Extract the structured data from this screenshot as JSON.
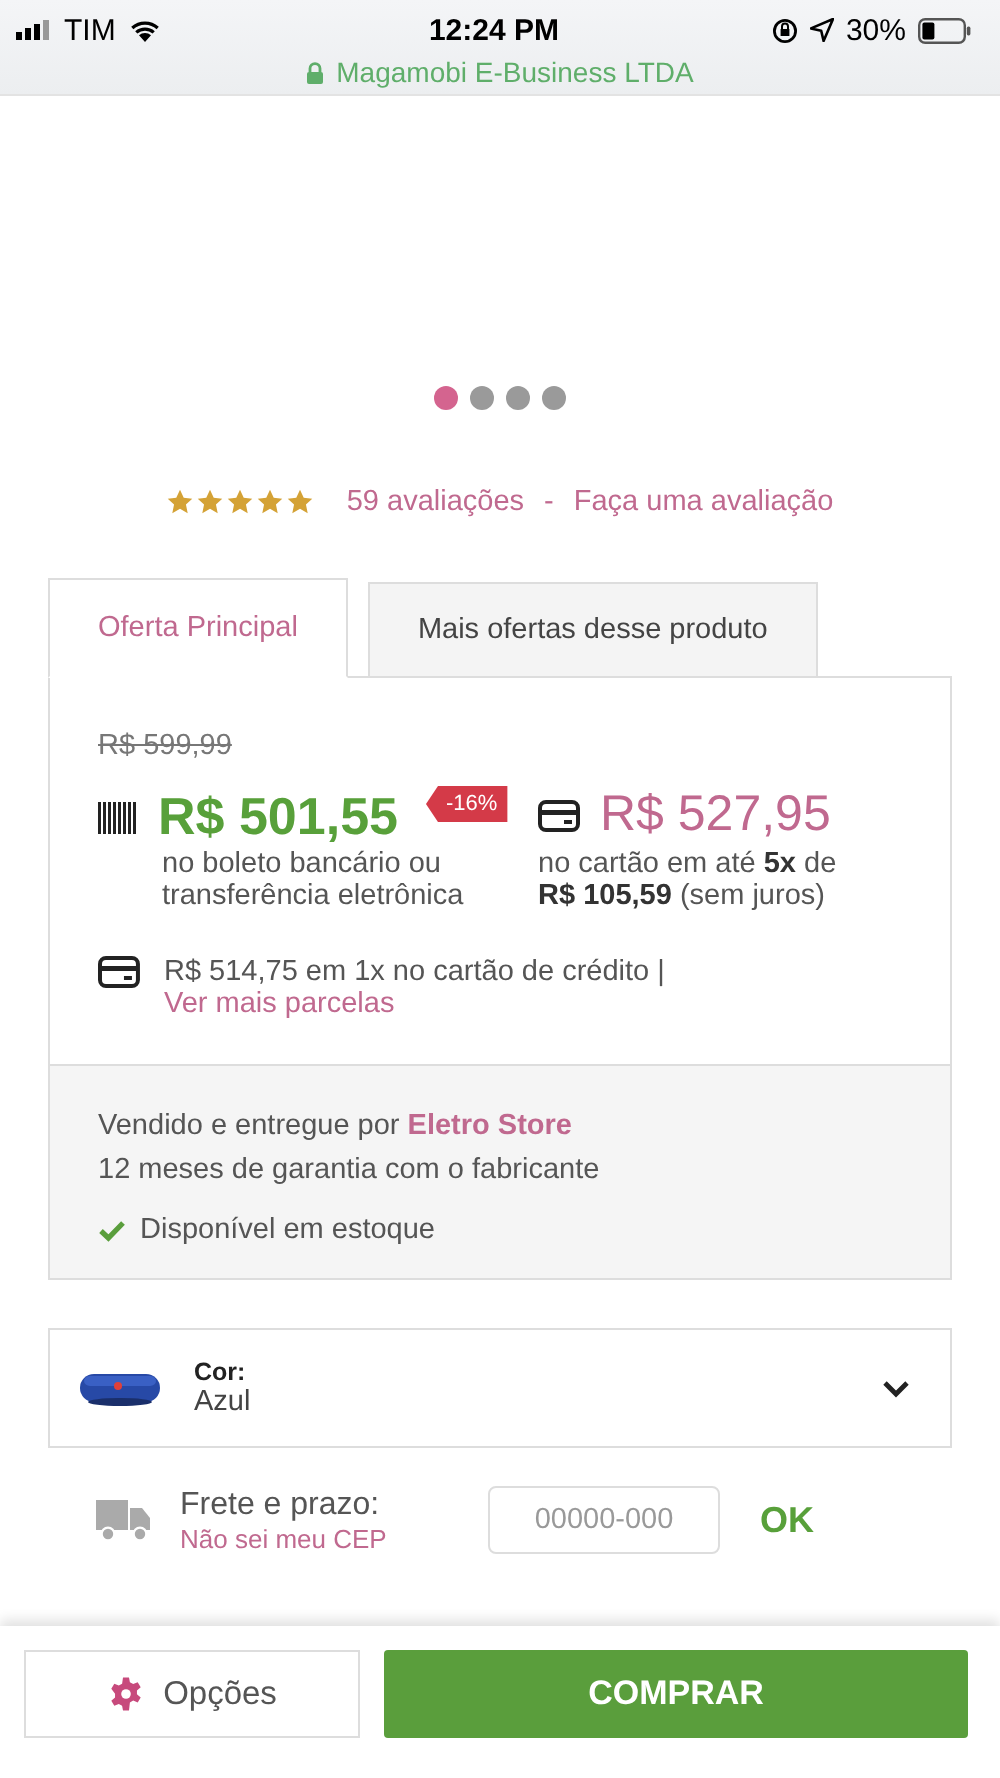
{
  "status_bar": {
    "carrier": "TIM",
    "time": "12:24 PM",
    "battery": "30%",
    "site": "Magamobi E-Business LTDA"
  },
  "gallery": {
    "dots": [
      {
        "selected": true
      },
      {
        "selected": false
      },
      {
        "selected": false
      },
      {
        "selected": false
      }
    ]
  },
  "rating": {
    "stars": 5,
    "reviews": "59 avaliações",
    "separator": "-",
    "write_review": "Faça uma avaliação"
  },
  "tabs": [
    {
      "label": "Oferta Principal",
      "selected": true
    },
    {
      "label": "Mais ofertas desse produto",
      "selected": false
    }
  ],
  "offer": {
    "old_price": "R$ 599,99",
    "boleto_price": "R$ 501,55",
    "discount": "-16%",
    "boleto_note": "no boleto bancário ou transferência eletrônica",
    "card_price": "R$ 527,95",
    "card_note": "no cartão em até **5x** de **R$ 105,59** (sem juros)",
    "credit_text": "R$ 514,75 em 1x no cartão de crédito |",
    "credit_link": "Ver mais parcelas"
  },
  "seller": {
    "label": "Vendido e entregue por",
    "name": "Eletro Store",
    "warranty": "12 meses de garantia com o fabricante",
    "stock": "Disponível em estoque"
  },
  "variant": {
    "label": "Cor:",
    "value": "Azul"
  },
  "shipping": {
    "label": "Frete e prazo:",
    "link": "Não sei meu CEP",
    "placeholder": "00000-000",
    "button": "OK"
  },
  "actions": {
    "options": "Opções",
    "buy": "COMPRAR"
  }
}
